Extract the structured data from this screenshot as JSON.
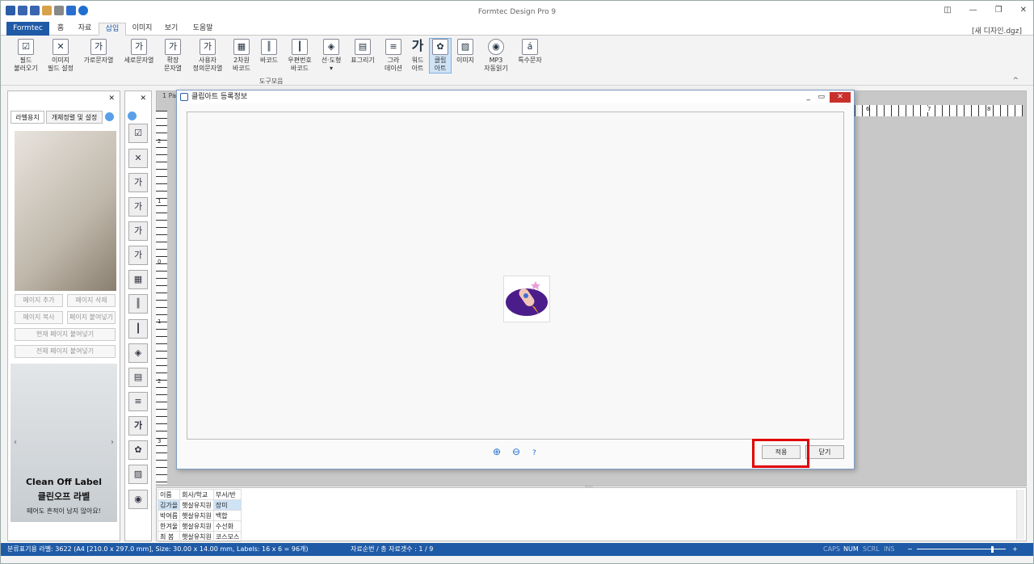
{
  "window": {
    "title": "Formtec Design Pro 9",
    "doc_name": "[새 디자인.dgz]"
  },
  "tabs": [
    {
      "label": "Formtec"
    },
    {
      "label": "홈"
    },
    {
      "label": "자료"
    },
    {
      "label": "삽입"
    },
    {
      "label": "이미지"
    },
    {
      "label": "보기"
    },
    {
      "label": "도움말"
    }
  ],
  "active_tab": "삽입",
  "ribbon": {
    "buttons": [
      {
        "label": "필드\n불러오기"
      },
      {
        "label": "이미지\n필드 설정"
      },
      {
        "label": "가로문자열"
      },
      {
        "label": "세로문자열"
      },
      {
        "label": "확장\n문자열"
      },
      {
        "label": "사용자\n정의문자열"
      },
      {
        "label": "2차원\n바코드"
      },
      {
        "label": "바코드"
      },
      {
        "label": "우편번호\n바코드"
      },
      {
        "label": "선·도형\n▾"
      },
      {
        "label": "표그리기"
      },
      {
        "label": "그라\n데이션"
      },
      {
        "label": "워드\n아트"
      },
      {
        "label": "클립\n아트"
      },
      {
        "label": "이미지"
      },
      {
        "label": "MP3\n자동읽기"
      },
      {
        "label": "특수문자"
      }
    ],
    "group_label": "도구모음"
  },
  "left_panel": {
    "tabs": [
      {
        "label": "라벨용지"
      },
      {
        "label": "개체정렬 및 설정"
      }
    ],
    "buttons": [
      {
        "label": "페이지 추가"
      },
      {
        "label": "페이지 삭제"
      },
      {
        "label": "페이지 복사"
      },
      {
        "label": "페이지 붙여넣기"
      },
      {
        "label": "현재 페이지 붙여넣기"
      },
      {
        "label": "전체 페이지 붙여넣기"
      }
    ],
    "ad": {
      "brand": "Clean Off Label",
      "title": "클린오프 라벨",
      "tagline": "떼어도 흔적이 남지 않아요!"
    }
  },
  "canvas": {
    "page_tab": "1 Pa",
    "ruler_marks": [
      "6",
      "7",
      "8"
    ],
    "vruler_marks": [
      "2",
      "1",
      "0",
      "1",
      "2",
      "3"
    ]
  },
  "dialog": {
    "title": "클립아트 등록정보",
    "buttons": {
      "apply": "적용",
      "close": "닫기"
    },
    "zoom_in": "⊕",
    "zoom_out": "⊖",
    "help": "?"
  },
  "data_grid": {
    "headers": [
      "이름",
      "회사/학교",
      "부서/반"
    ],
    "rows": [
      [
        "김가을",
        "햇살유치원",
        "장미"
      ],
      [
        "박여름",
        "햇살유치원",
        "백합"
      ],
      [
        "한겨울",
        "햇살유치원",
        "수선화"
      ],
      [
        "최  봄",
        "햇살유치원",
        "코스모스"
      ]
    ]
  },
  "status": {
    "left": "분류표기용 라벨: 3622 (A4 [210.0 x 297.0 mm], Size: 30.00 x 14.00 mm,  Labels: 16 x 6 = 96개)",
    "middle": "자료순번 / 총 자료갯수 : 1 / 9",
    "indicators": [
      "CAPS",
      "NUM",
      "SCRL",
      "INS"
    ]
  },
  "colors": {
    "accent": "#1f5aa6",
    "highlight": "#e00000"
  }
}
